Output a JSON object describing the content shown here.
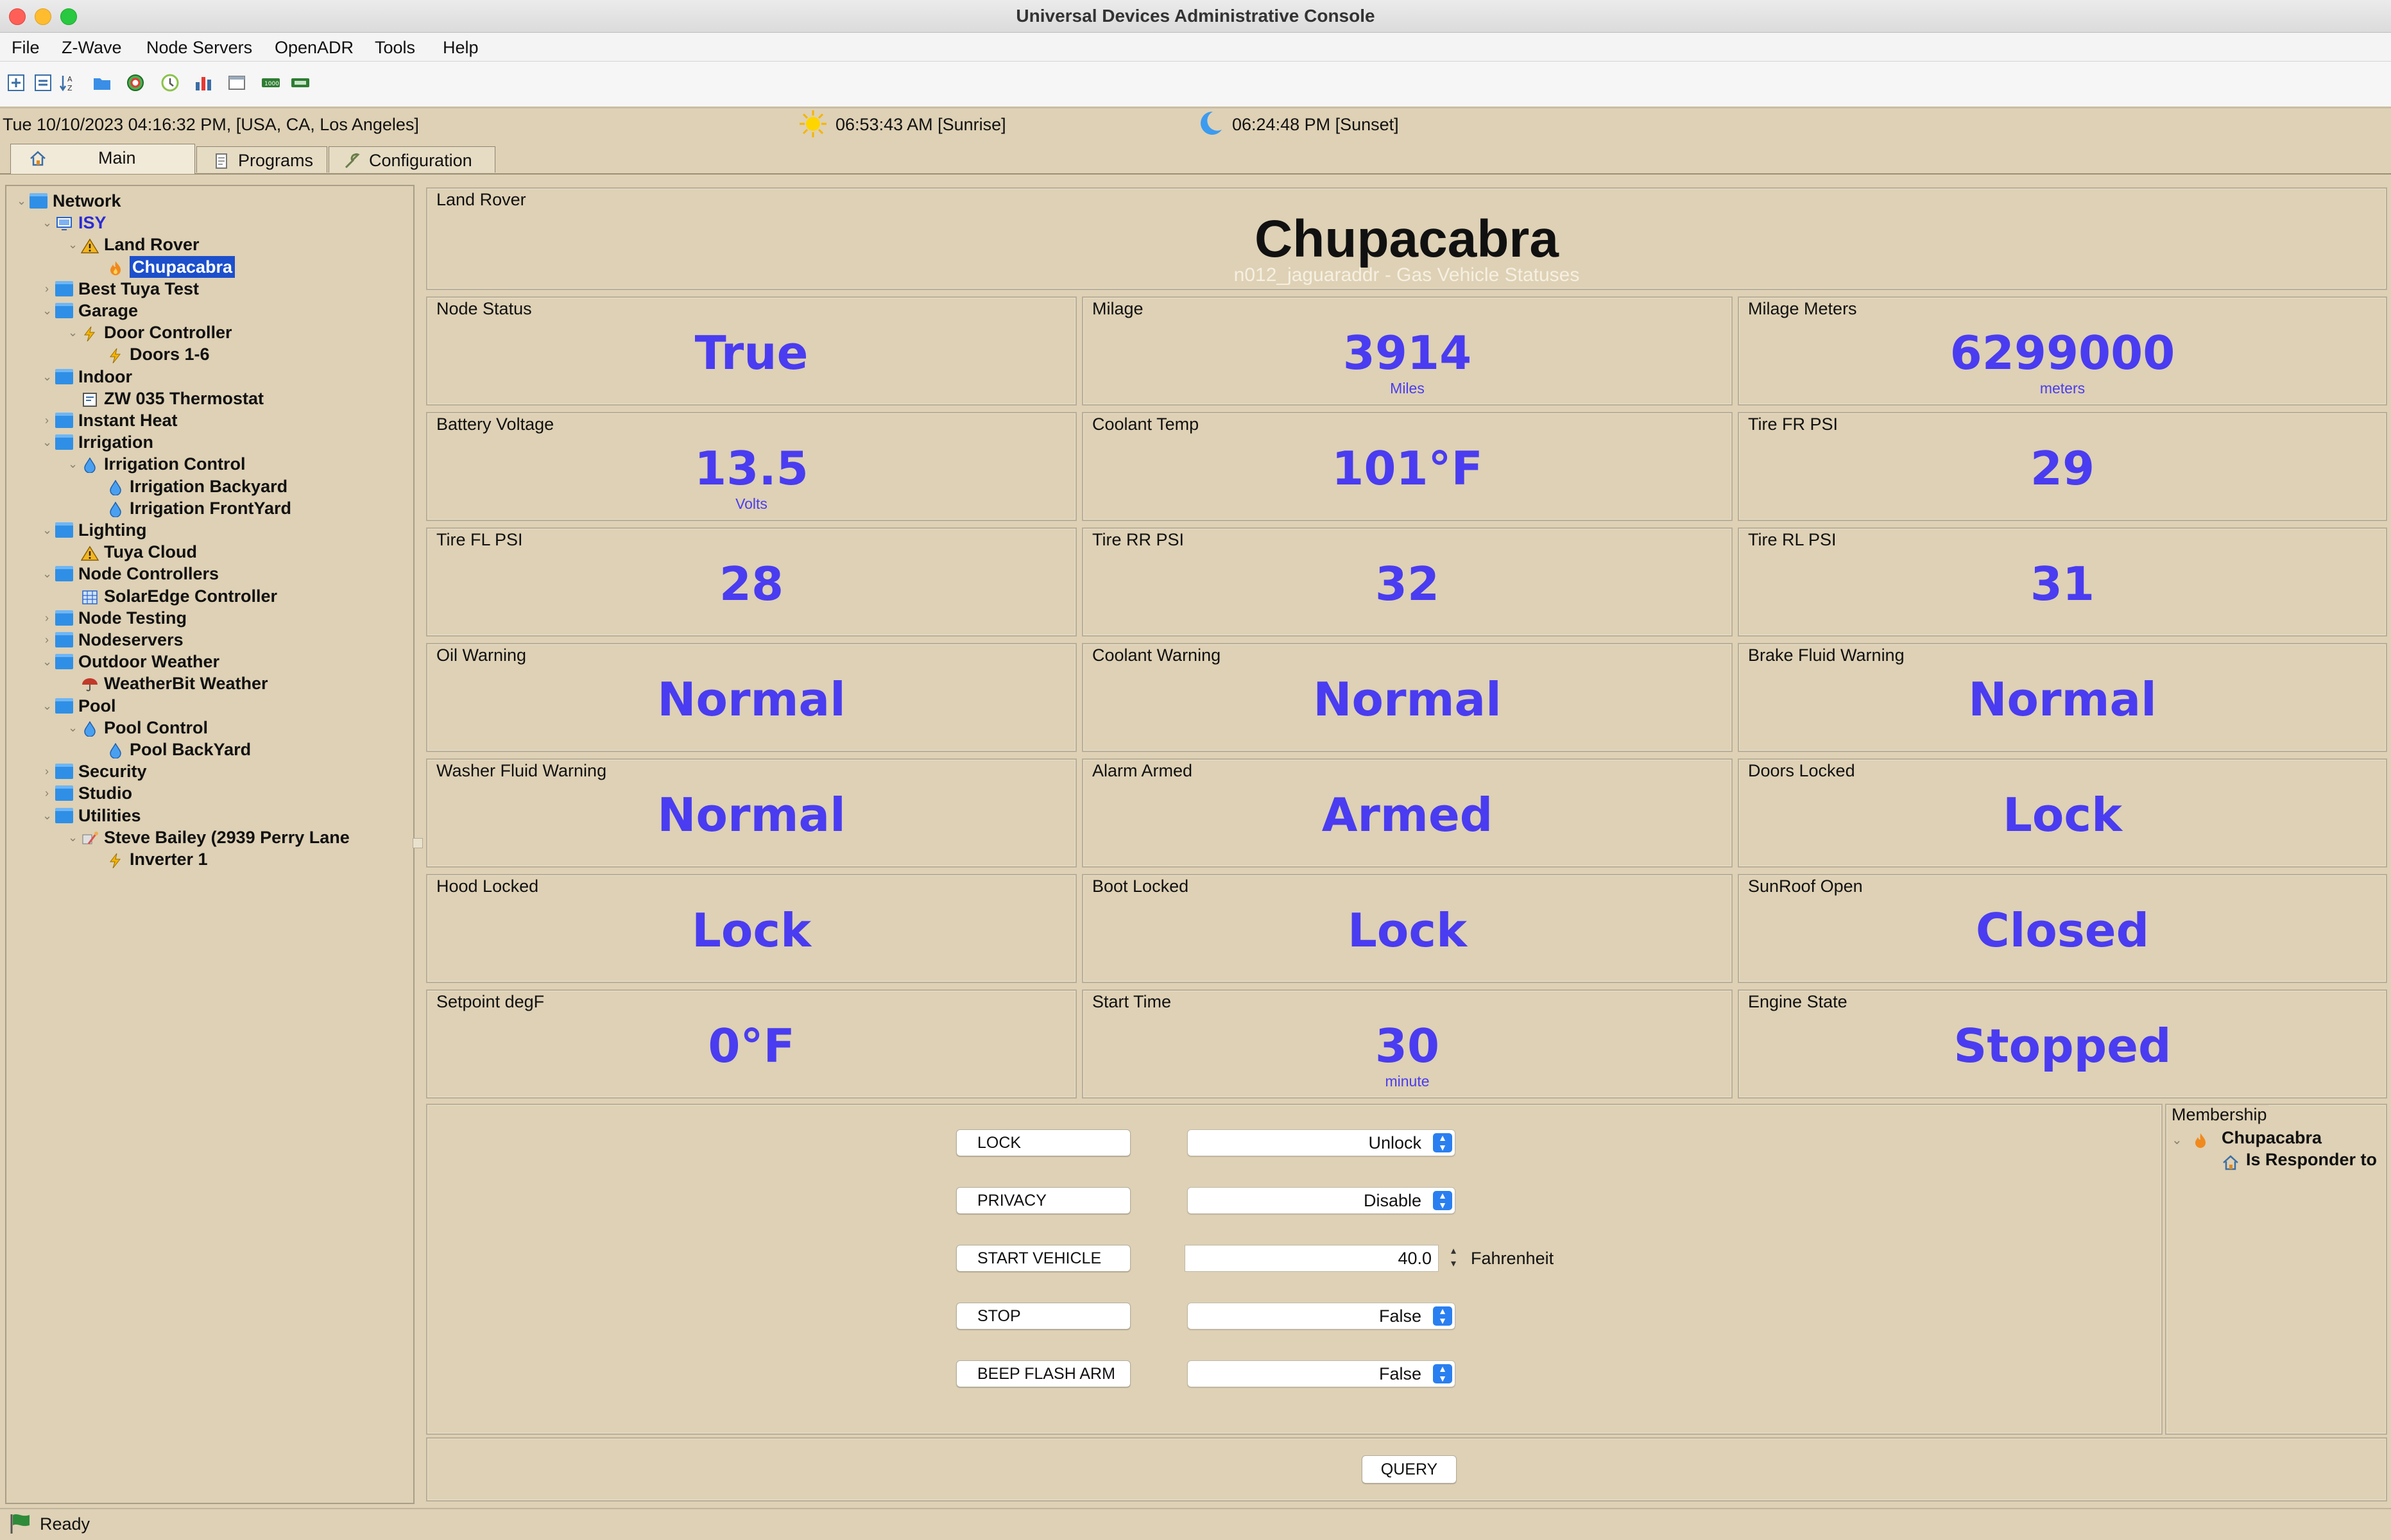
{
  "window": {
    "title": "Universal Devices Administrative Console"
  },
  "menu": [
    "File",
    "Z-Wave",
    "Node Servers",
    "OpenADR",
    "Tools",
    "Help"
  ],
  "toolbar_icons": [
    "expand-all-icon",
    "collapse-all-icon",
    "sort-icon",
    "folder-icon",
    "globe-icon",
    "clock-icon",
    "bar-chart-icon",
    "window-icon",
    "battery-icon",
    "energy-meter-icon"
  ],
  "info": {
    "datetime": "Tue 10/10/2023 04:16:32 PM,  [USA, CA, Los Angeles]",
    "sunrise": "06:53:43 AM [Sunrise]",
    "sunset": "06:24:48 PM [Sunset]"
  },
  "tabs": [
    {
      "label": "Main",
      "icon": "home-icon"
    },
    {
      "label": "Programs",
      "icon": "document-icon"
    },
    {
      "label": "Configuration",
      "icon": "wrench-icon"
    }
  ],
  "tree": [
    {
      "label": "Network",
      "icon": "folder",
      "depth": 0,
      "expanded": true
    },
    {
      "label": "ISY",
      "icon": "monitor",
      "depth": 1,
      "expanded": true,
      "style": "blue"
    },
    {
      "label": "Land Rover",
      "icon": "warning",
      "depth": 2,
      "expanded": true
    },
    {
      "label": "Chupacabra",
      "icon": "flame",
      "depth": 3,
      "selected": true
    },
    {
      "label": "Best Tuya Test",
      "icon": "folder",
      "depth": 1
    },
    {
      "label": "Garage",
      "icon": "folder",
      "depth": 1,
      "expanded": true
    },
    {
      "label": "Door Controller",
      "icon": "bolt",
      "depth": 2,
      "expanded": true
    },
    {
      "label": "Doors 1-6",
      "icon": "bolt",
      "depth": 3
    },
    {
      "label": "Indoor",
      "icon": "folder",
      "depth": 1,
      "expanded": true
    },
    {
      "label": "ZW 035 Thermostat",
      "icon": "thermostat",
      "depth": 2
    },
    {
      "label": "Instant Heat",
      "icon": "folder",
      "depth": 1
    },
    {
      "label": "Irrigation",
      "icon": "folder",
      "depth": 1,
      "expanded": true
    },
    {
      "label": "Irrigation Control",
      "icon": "drop",
      "depth": 2,
      "expanded": true
    },
    {
      "label": "Irrigation Backyard",
      "icon": "drop",
      "depth": 3
    },
    {
      "label": "Irrigation FrontYard",
      "icon": "drop",
      "depth": 3
    },
    {
      "label": "Lighting",
      "icon": "folder",
      "depth": 1,
      "expanded": true
    },
    {
      "label": "Tuya Cloud",
      "icon": "warning",
      "depth": 2
    },
    {
      "label": "Node Controllers",
      "icon": "folder",
      "depth": 1,
      "expanded": true
    },
    {
      "label": "SolarEdge Controller",
      "icon": "solar",
      "depth": 2
    },
    {
      "label": "Node Testing",
      "icon": "folder",
      "depth": 1
    },
    {
      "label": "Nodeservers",
      "icon": "folder",
      "depth": 1
    },
    {
      "label": "Outdoor Weather",
      "icon": "folder",
      "depth": 1,
      "expanded": true
    },
    {
      "label": "WeatherBit Weather",
      "icon": "umbrella",
      "depth": 2
    },
    {
      "label": "Pool",
      "icon": "folder",
      "depth": 1,
      "expanded": true
    },
    {
      "label": "Pool Control",
      "icon": "drop",
      "depth": 2,
      "expanded": true
    },
    {
      "label": "Pool BackYard",
      "icon": "drop",
      "depth": 3
    },
    {
      "label": "Security",
      "icon": "folder",
      "depth": 1
    },
    {
      "label": "Studio",
      "icon": "folder",
      "depth": 1
    },
    {
      "label": "Utilities",
      "icon": "folder",
      "depth": 1,
      "expanded": true
    },
    {
      "label": "Steve Bailey (2939 Perry Lane",
      "icon": "meter",
      "depth": 2,
      "expanded": true
    },
    {
      "label": "Inverter 1",
      "icon": "bolt",
      "depth": 3
    }
  ],
  "node": {
    "group_label": "Land Rover",
    "name": "Chupacabra",
    "subtitle": "n012_jaguaraddr - Gas Vehicle Statuses"
  },
  "statuses": [
    {
      "label": "Node Status",
      "value": "True",
      "unit": ""
    },
    {
      "label": "Milage",
      "value": "3914",
      "unit": "Miles"
    },
    {
      "label": "Milage Meters",
      "value": "6299000",
      "unit": "meters"
    },
    {
      "label": "Battery Voltage",
      "value": "13.5",
      "unit": "Volts"
    },
    {
      "label": "Coolant Temp",
      "value": "101°F",
      "unit": ""
    },
    {
      "label": "Tire FR PSI",
      "value": "29",
      "unit": ""
    },
    {
      "label": "Tire FL PSI",
      "value": "28",
      "unit": ""
    },
    {
      "label": "Tire RR PSI",
      "value": "32",
      "unit": ""
    },
    {
      "label": "Tire RL PSI",
      "value": "31",
      "unit": ""
    },
    {
      "label": "Oil Warning",
      "value": "Normal",
      "unit": ""
    },
    {
      "label": "Coolant Warning",
      "value": "Normal",
      "unit": ""
    },
    {
      "label": "Brake Fluid Warning",
      "value": "Normal",
      "unit": ""
    },
    {
      "label": "Washer Fluid Warning",
      "value": "Normal",
      "unit": ""
    },
    {
      "label": "Alarm Armed",
      "value": "Armed",
      "unit": ""
    },
    {
      "label": "Doors Locked",
      "value": "Lock",
      "unit": ""
    },
    {
      "label": "Hood Locked",
      "value": "Lock",
      "unit": ""
    },
    {
      "label": "Boot Locked",
      "value": "Lock",
      "unit": ""
    },
    {
      "label": "SunRoof Open",
      "value": "Closed",
      "unit": ""
    },
    {
      "label": "Setpoint degF",
      "value": "0°F",
      "unit": ""
    },
    {
      "label": "Start Time",
      "value": "30",
      "unit": "minute"
    },
    {
      "label": "Engine State",
      "value": "Stopped",
      "unit": ""
    }
  ],
  "commands": [
    {
      "button": "LOCK",
      "kind": "select",
      "value": "Unlock"
    },
    {
      "button": "PRIVACY",
      "kind": "select",
      "value": "Disable"
    },
    {
      "button": "START VEHICLE",
      "kind": "spinner",
      "value": "40.0",
      "unit": "Fahrenheit"
    },
    {
      "button": "STOP",
      "kind": "select",
      "value": "False"
    },
    {
      "button": "BEEP FLASH ARM",
      "kind": "select",
      "value": "False"
    }
  ],
  "membership": {
    "title": "Membership",
    "node": "Chupacabra",
    "relation": "Is Responder to"
  },
  "query_label": "QUERY",
  "status": {
    "text": "Ready"
  },
  "colors": {
    "value_blue": "#4a3cf0",
    "panel_tan": "#ded1b5",
    "selection": "#1c4fcc"
  }
}
